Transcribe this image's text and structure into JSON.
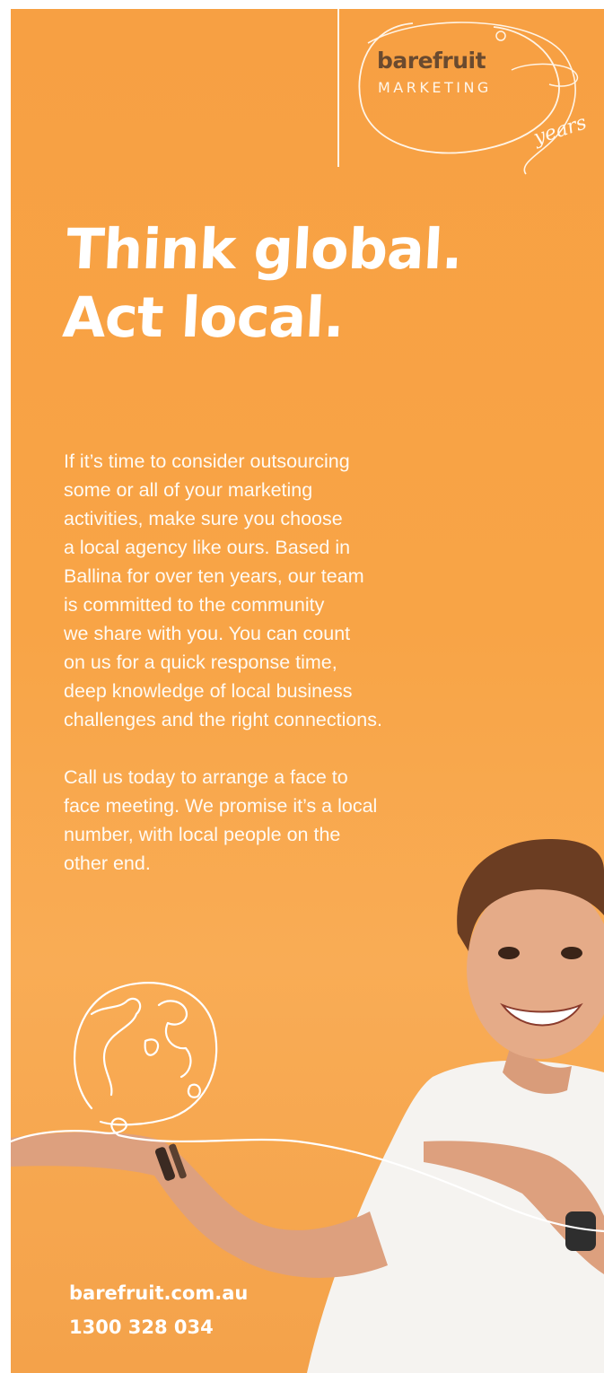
{
  "logo": {
    "brand": "barefruit",
    "sub": "MARKETING",
    "years": "years"
  },
  "headline": {
    "line1": "Think global.",
    "line2": "Act local."
  },
  "body": {
    "paragraph1": "If it’s time to consider outsourcing\nsome or all of your marketing\nactivities, make sure you choose\na local agency like ours. Based in\nBallina for over ten years, our team\nis committed to the community\nwe share with you. You can count\non us for a quick response time,\ndeep knowledge of local business\nchallenges and the right connections.",
    "paragraph2": "Call us today to arrange a face to\nface meeting. We promise it’s a local\nnumber, with local people on the\nother end."
  },
  "contact": {
    "website": "barefruit.com.au",
    "phone": "1300 328 034"
  },
  "colors": {
    "background": "#f7a043",
    "text": "#ffffff",
    "logo_brand": "#6a4a2f"
  },
  "icons": [
    "globe-icon"
  ]
}
